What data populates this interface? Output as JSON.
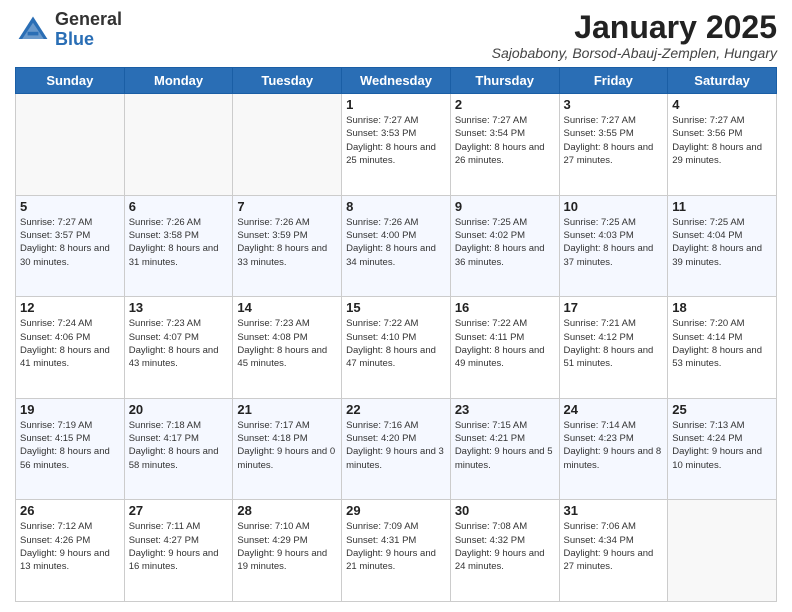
{
  "header": {
    "logo_general": "General",
    "logo_blue": "Blue",
    "month_title": "January 2025",
    "location": "Sajobabony, Borsod-Abauj-Zemplen, Hungary"
  },
  "days_of_week": [
    "Sunday",
    "Monday",
    "Tuesday",
    "Wednesday",
    "Thursday",
    "Friday",
    "Saturday"
  ],
  "weeks": [
    [
      {
        "day": "",
        "info": ""
      },
      {
        "day": "",
        "info": ""
      },
      {
        "day": "",
        "info": ""
      },
      {
        "day": "1",
        "info": "Sunrise: 7:27 AM\nSunset: 3:53 PM\nDaylight: 8 hours and 25 minutes."
      },
      {
        "day": "2",
        "info": "Sunrise: 7:27 AM\nSunset: 3:54 PM\nDaylight: 8 hours and 26 minutes."
      },
      {
        "day": "3",
        "info": "Sunrise: 7:27 AM\nSunset: 3:55 PM\nDaylight: 8 hours and 27 minutes."
      },
      {
        "day": "4",
        "info": "Sunrise: 7:27 AM\nSunset: 3:56 PM\nDaylight: 8 hours and 29 minutes."
      }
    ],
    [
      {
        "day": "5",
        "info": "Sunrise: 7:27 AM\nSunset: 3:57 PM\nDaylight: 8 hours and 30 minutes."
      },
      {
        "day": "6",
        "info": "Sunrise: 7:26 AM\nSunset: 3:58 PM\nDaylight: 8 hours and 31 minutes."
      },
      {
        "day": "7",
        "info": "Sunrise: 7:26 AM\nSunset: 3:59 PM\nDaylight: 8 hours and 33 minutes."
      },
      {
        "day": "8",
        "info": "Sunrise: 7:26 AM\nSunset: 4:00 PM\nDaylight: 8 hours and 34 minutes."
      },
      {
        "day": "9",
        "info": "Sunrise: 7:25 AM\nSunset: 4:02 PM\nDaylight: 8 hours and 36 minutes."
      },
      {
        "day": "10",
        "info": "Sunrise: 7:25 AM\nSunset: 4:03 PM\nDaylight: 8 hours and 37 minutes."
      },
      {
        "day": "11",
        "info": "Sunrise: 7:25 AM\nSunset: 4:04 PM\nDaylight: 8 hours and 39 minutes."
      }
    ],
    [
      {
        "day": "12",
        "info": "Sunrise: 7:24 AM\nSunset: 4:06 PM\nDaylight: 8 hours and 41 minutes."
      },
      {
        "day": "13",
        "info": "Sunrise: 7:23 AM\nSunset: 4:07 PM\nDaylight: 8 hours and 43 minutes."
      },
      {
        "day": "14",
        "info": "Sunrise: 7:23 AM\nSunset: 4:08 PM\nDaylight: 8 hours and 45 minutes."
      },
      {
        "day": "15",
        "info": "Sunrise: 7:22 AM\nSunset: 4:10 PM\nDaylight: 8 hours and 47 minutes."
      },
      {
        "day": "16",
        "info": "Sunrise: 7:22 AM\nSunset: 4:11 PM\nDaylight: 8 hours and 49 minutes."
      },
      {
        "day": "17",
        "info": "Sunrise: 7:21 AM\nSunset: 4:12 PM\nDaylight: 8 hours and 51 minutes."
      },
      {
        "day": "18",
        "info": "Sunrise: 7:20 AM\nSunset: 4:14 PM\nDaylight: 8 hours and 53 minutes."
      }
    ],
    [
      {
        "day": "19",
        "info": "Sunrise: 7:19 AM\nSunset: 4:15 PM\nDaylight: 8 hours and 56 minutes."
      },
      {
        "day": "20",
        "info": "Sunrise: 7:18 AM\nSunset: 4:17 PM\nDaylight: 8 hours and 58 minutes."
      },
      {
        "day": "21",
        "info": "Sunrise: 7:17 AM\nSunset: 4:18 PM\nDaylight: 9 hours and 0 minutes."
      },
      {
        "day": "22",
        "info": "Sunrise: 7:16 AM\nSunset: 4:20 PM\nDaylight: 9 hours and 3 minutes."
      },
      {
        "day": "23",
        "info": "Sunrise: 7:15 AM\nSunset: 4:21 PM\nDaylight: 9 hours and 5 minutes."
      },
      {
        "day": "24",
        "info": "Sunrise: 7:14 AM\nSunset: 4:23 PM\nDaylight: 9 hours and 8 minutes."
      },
      {
        "day": "25",
        "info": "Sunrise: 7:13 AM\nSunset: 4:24 PM\nDaylight: 9 hours and 10 minutes."
      }
    ],
    [
      {
        "day": "26",
        "info": "Sunrise: 7:12 AM\nSunset: 4:26 PM\nDaylight: 9 hours and 13 minutes."
      },
      {
        "day": "27",
        "info": "Sunrise: 7:11 AM\nSunset: 4:27 PM\nDaylight: 9 hours and 16 minutes."
      },
      {
        "day": "28",
        "info": "Sunrise: 7:10 AM\nSunset: 4:29 PM\nDaylight: 9 hours and 19 minutes."
      },
      {
        "day": "29",
        "info": "Sunrise: 7:09 AM\nSunset: 4:31 PM\nDaylight: 9 hours and 21 minutes."
      },
      {
        "day": "30",
        "info": "Sunrise: 7:08 AM\nSunset: 4:32 PM\nDaylight: 9 hours and 24 minutes."
      },
      {
        "day": "31",
        "info": "Sunrise: 7:06 AM\nSunset: 4:34 PM\nDaylight: 9 hours and 27 minutes."
      },
      {
        "day": "",
        "info": ""
      }
    ]
  ]
}
